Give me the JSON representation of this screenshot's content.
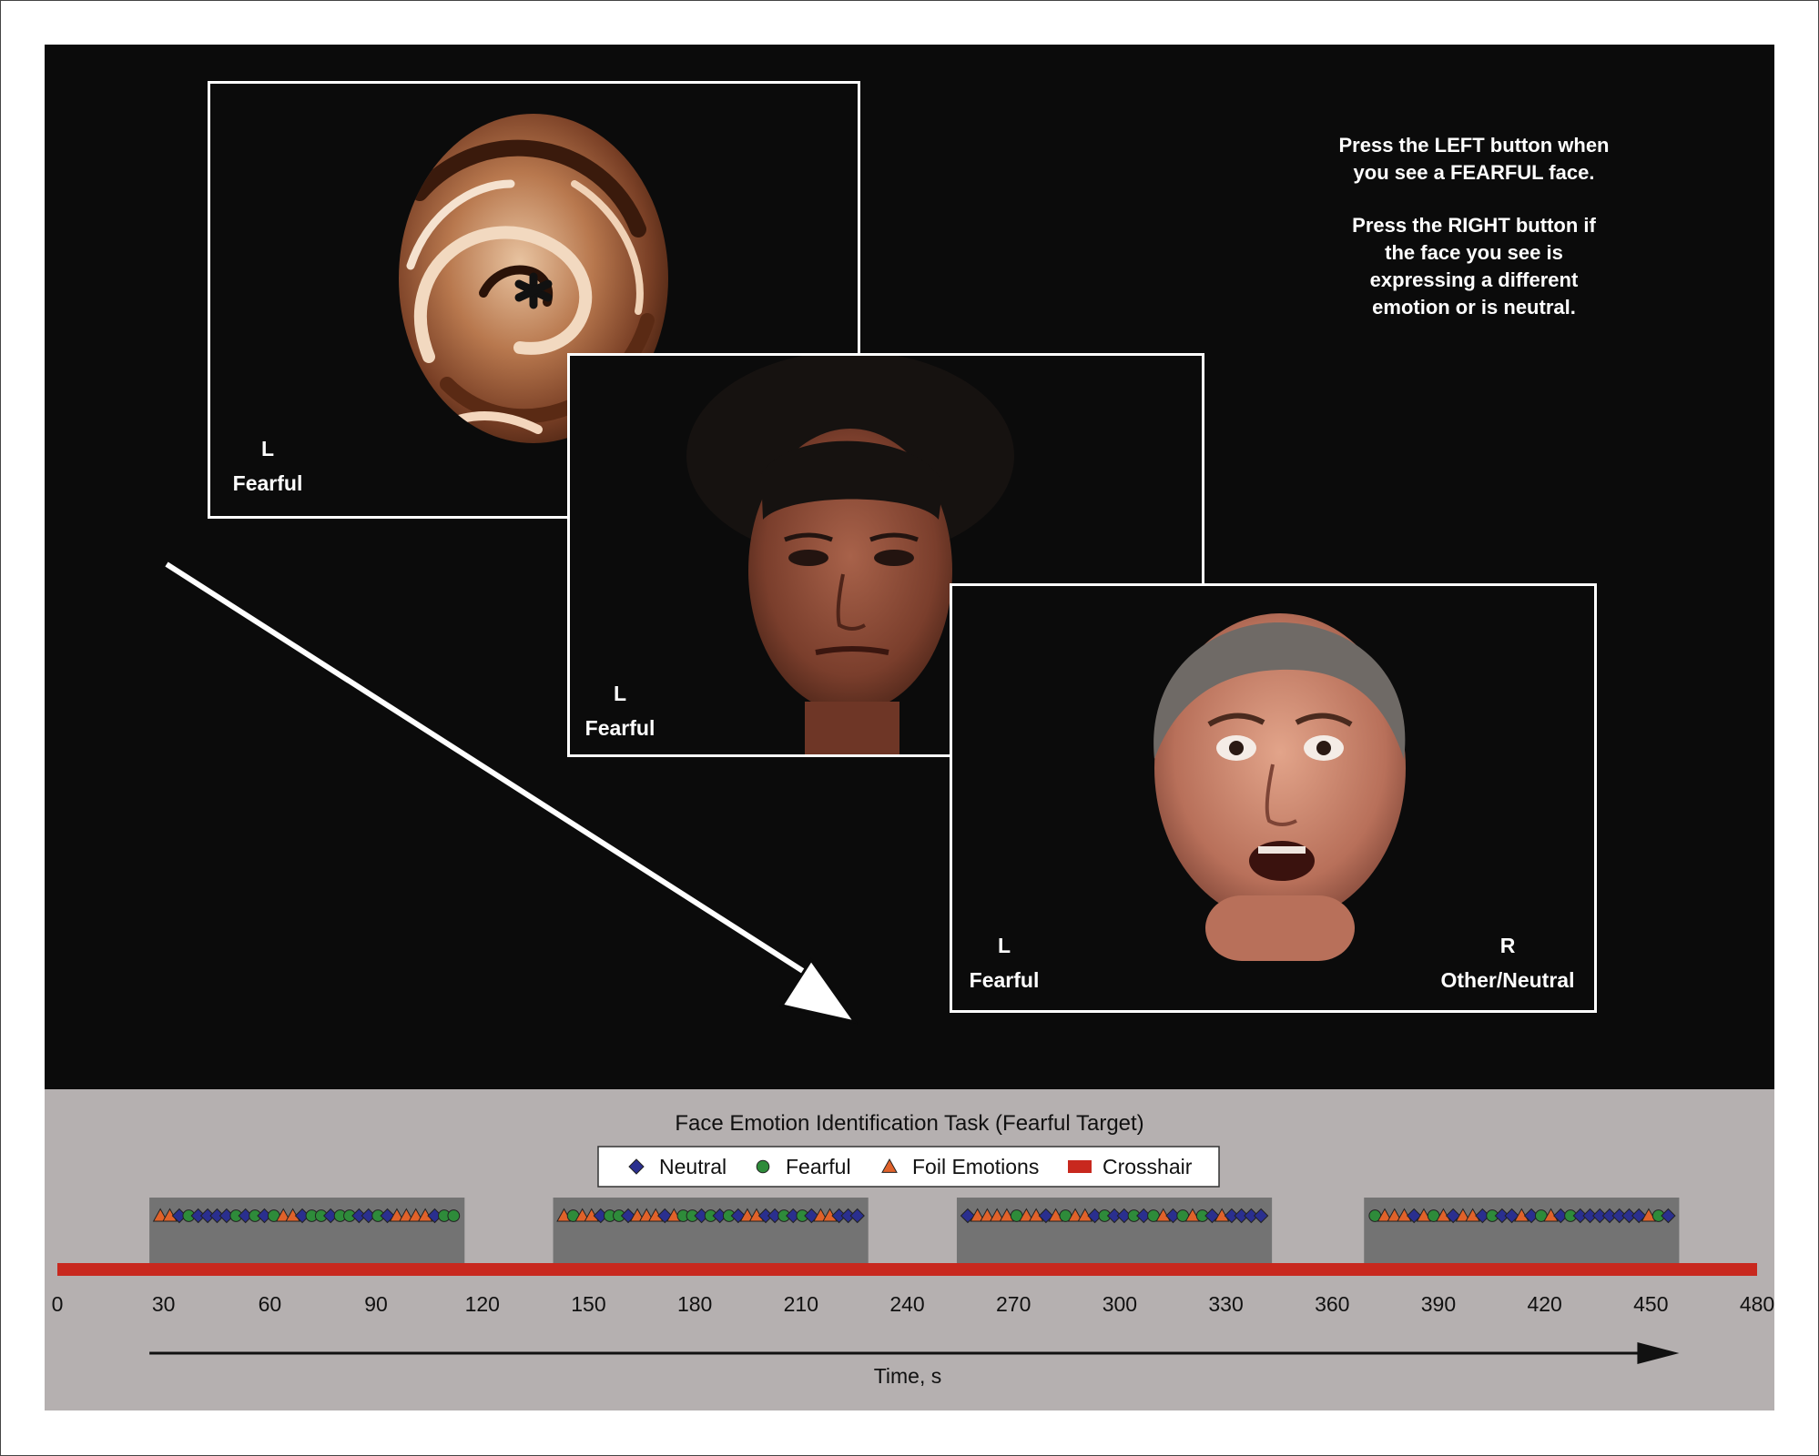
{
  "instructions": {
    "line1": "Press the LEFT button when",
    "line2": "you see a FEARFUL face.",
    "line3": "Press the RIGHT button if",
    "line4": "the face you see is",
    "line5": "expressing a different",
    "line6": "emotion or is neutral."
  },
  "screens": [
    {
      "key": "L",
      "label": "Fearful"
    },
    {
      "key": "L",
      "label": "Fearful"
    },
    {
      "key_left": "L",
      "label_left": "Fearful",
      "key_right": "R",
      "label_right": "Other/Neutral"
    }
  ],
  "timeline": {
    "title": "Face Emotion Identification Task (Fearful Target)",
    "xlabel": "Time, s",
    "legend": [
      {
        "name": "Neutral",
        "shape": "diamond",
        "color": "#2a2f8f"
      },
      {
        "name": "Fearful",
        "shape": "circle",
        "color": "#2e8b3a"
      },
      {
        "name": "Foil Emotions",
        "shape": "triangle",
        "color": "#e0622a"
      },
      {
        "name": "Crosshair",
        "shape": "bar",
        "color": "#c8281e"
      }
    ],
    "ticks": [
      0,
      30,
      60,
      90,
      120,
      150,
      180,
      210,
      240,
      270,
      300,
      330,
      360,
      390,
      420,
      450,
      480
    ],
    "x_range": [
      0,
      480
    ],
    "crosshair_range": [
      0,
      480
    ],
    "blocks": [
      {
        "start": 26,
        "end": 115,
        "sequence": "TTDCDDDDCDCDCTTDCCDCCDDCDTTTTDCC"
      },
      {
        "start": 140,
        "end": 229,
        "sequence": "TCTTDCCDTTTDTCCDCDCDTTDDCDCDTTDDD"
      },
      {
        "start": 254,
        "end": 343,
        "sequence": "DTTTTCTTDTCTTDCDDCDCTDCTCDTDDDD"
      },
      {
        "start": 369,
        "end": 458,
        "sequence": "CTTTDTCTDTTDCDDTDCTDCDDDDDDDTCD"
      }
    ],
    "colors": {
      "block": "#737373",
      "crosshair": "#c8281e",
      "arrow": "#111111"
    }
  }
}
